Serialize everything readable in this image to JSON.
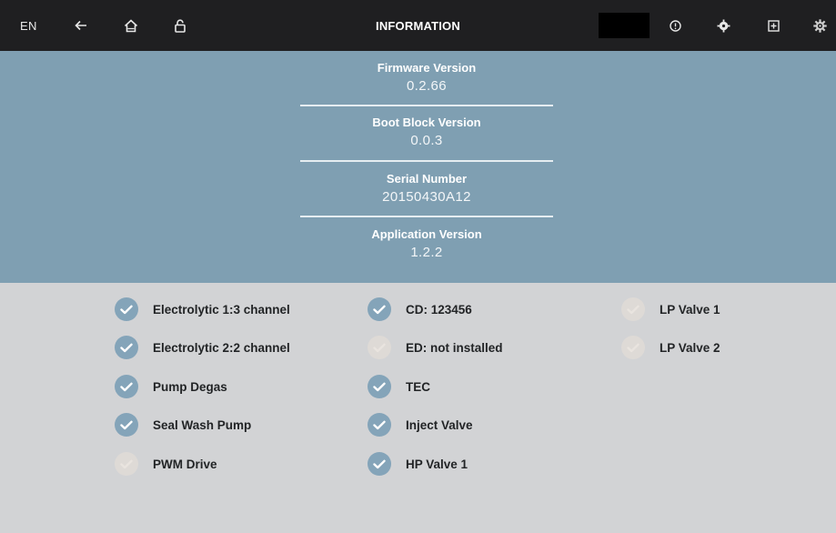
{
  "topbar": {
    "language": "EN",
    "title": "INFORMATION",
    "icons": [
      "back-arrow-icon",
      "home-icon",
      "lock-icon",
      "info-circle-icon",
      "settings-sun-icon",
      "export-icon",
      "gear-icon"
    ]
  },
  "info": [
    {
      "label": "Firmware Version",
      "value": "0.2.66"
    },
    {
      "label": "Boot Block Version",
      "value": "0.0.3"
    },
    {
      "label": "Serial Number",
      "value": "20150430A12"
    },
    {
      "label": "Application Version",
      "value": "1.2.2"
    }
  ],
  "features": {
    "col1": [
      {
        "label": "Electrolytic 1:3 channel",
        "installed": true
      },
      {
        "label": "Electrolytic 2:2 channel",
        "installed": true
      },
      {
        "label": "Pump Degas",
        "installed": true
      },
      {
        "label": "Seal Wash Pump",
        "installed": true
      },
      {
        "label": "PWM Drive",
        "installed": false
      }
    ],
    "col2": [
      {
        "label": "CD: 123456",
        "installed": true
      },
      {
        "label": "ED: not installed",
        "installed": false
      },
      {
        "label": "TEC",
        "installed": true
      },
      {
        "label": "Inject Valve",
        "installed": true
      },
      {
        "label": "HP Valve 1",
        "installed": true
      }
    ],
    "col3": [
      {
        "label": "LP Valve 1",
        "installed": false
      },
      {
        "label": "LP Valve 2",
        "installed": false
      }
    ]
  },
  "colors": {
    "topbar": "#1f1f21",
    "info_panel": "#7f9fb2",
    "background": "#d2d3d5",
    "check_on": "#84a4b9",
    "check_off": "#dedad6"
  }
}
